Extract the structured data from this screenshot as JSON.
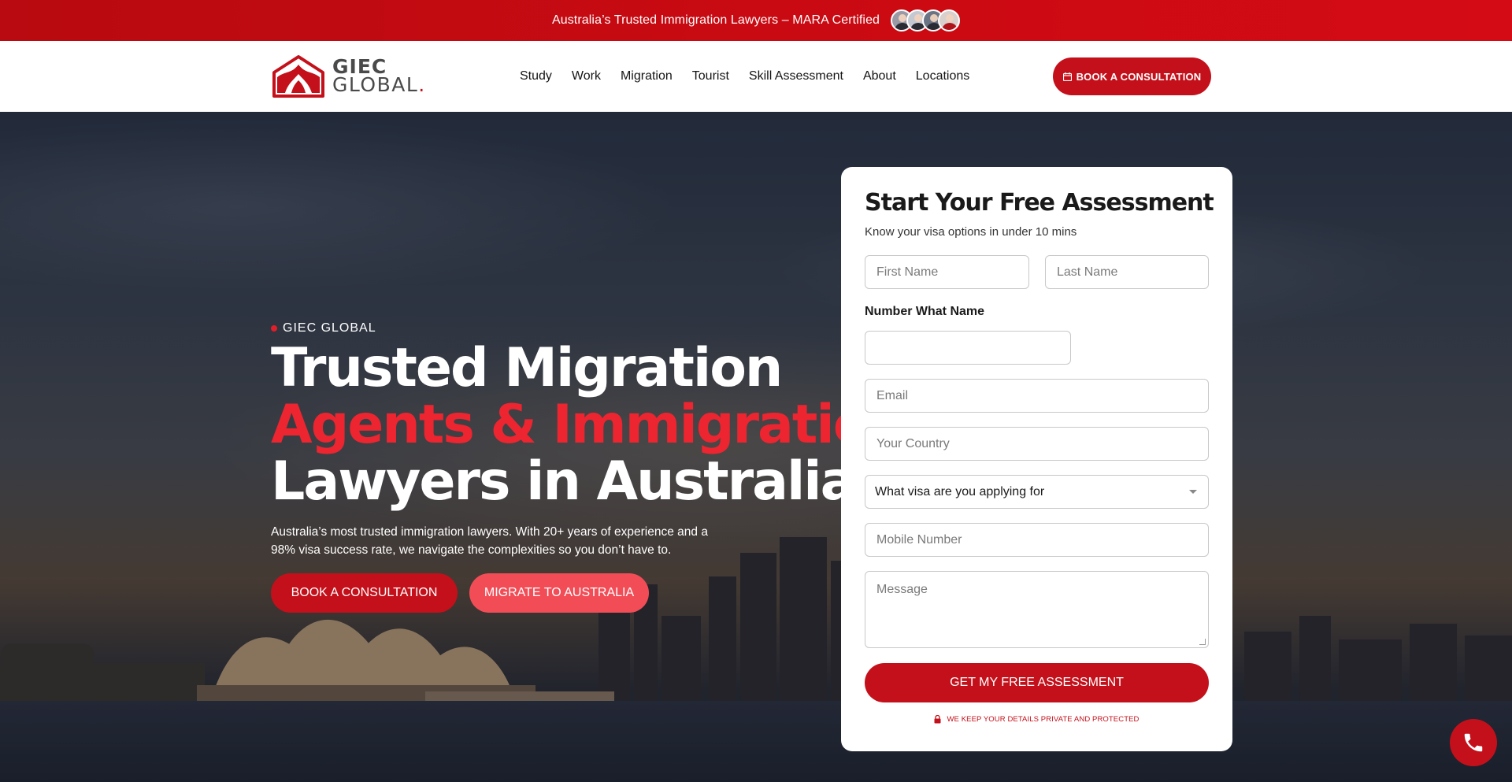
{
  "banner": {
    "text": "Australia’s Trusted Immigration Lawyers –  MARA Certified",
    "avatars": [
      "lawyer-avatar-1",
      "lawyer-avatar-2",
      "lawyer-avatar-3",
      "lawyer-avatar-4"
    ]
  },
  "brand": {
    "logo_line1": "GIEC",
    "logo_line2": "GLOBAL",
    "logo_dot": ".",
    "accent": "#c4101a"
  },
  "nav": {
    "items": [
      {
        "label": "Study"
      },
      {
        "label": "Work"
      },
      {
        "label": "Migration"
      },
      {
        "label": "Tourist"
      },
      {
        "label": "Skill Assessment"
      },
      {
        "label": "About"
      },
      {
        "label": "Locations"
      }
    ],
    "cta_label": "BOOK A CONSULTATION",
    "cta_icon": "calendar-icon"
  },
  "hero": {
    "eyebrow": "GIEC GLOBAL",
    "title_line1": "Trusted Migration",
    "title_line2": "Agents & Immigration",
    "title_line3": "Lawyers in Australia",
    "description": "Australia’s most trusted immigration lawyers. With 20+ years of experience and a 98% visa success rate, we navigate the complexities so you don’t have to.",
    "primary_button": "BOOK A CONSULTATION",
    "secondary_button": "MIGRATE TO AUSTRALIA"
  },
  "form": {
    "title": "Start Your Free Assessment",
    "subtitle": "Know your visa options in under 10 mins",
    "first_name_placeholder": "First Name",
    "last_name_placeholder": "Last Name",
    "number_label": "Number What Name",
    "number_value": "",
    "email_placeholder": "Email",
    "country_placeholder": "Your Country",
    "visa_select_value": "What visa are you applying for",
    "mobile_placeholder": "Mobile Number",
    "message_placeholder": "Message",
    "submit_label": "GET MY FREE ASSESSMENT",
    "privacy_text": "WE KEEP YOUR DETAILS PRIVATE AND PROTECTED",
    "privacy_icon": "lock-icon"
  },
  "floating": {
    "call_icon": "phone-icon"
  }
}
